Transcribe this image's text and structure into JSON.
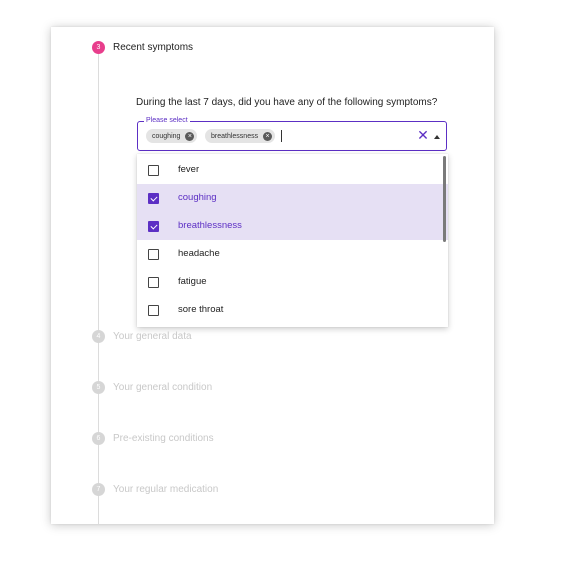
{
  "steps": [
    {
      "number": "3",
      "label": "Recent symptoms",
      "state": "active"
    },
    {
      "number": "4",
      "label": "Your general data",
      "state": "inactive"
    },
    {
      "number": "5",
      "label": "Your general condition",
      "state": "inactive"
    },
    {
      "number": "6",
      "label": "Pre-existing conditions",
      "state": "inactive"
    },
    {
      "number": "7",
      "label": "Your regular medication",
      "state": "inactive"
    }
  ],
  "question": "During the last 7 days, did you have any of the following symptoms?",
  "select": {
    "label": "Please select",
    "chips": [
      {
        "label": "coughing"
      },
      {
        "label": "breathlessness"
      }
    ],
    "clear_icon": "close-icon",
    "toggle_icon": "arrow-up-icon"
  },
  "options": [
    {
      "label": "fever",
      "checked": false
    },
    {
      "label": "coughing",
      "checked": true
    },
    {
      "label": "breathlessness",
      "checked": true
    },
    {
      "label": "headache",
      "checked": false
    },
    {
      "label": "fatigue",
      "checked": false
    },
    {
      "label": "sore throat",
      "checked": false
    }
  ],
  "colors": {
    "accent": "#5c2fc4",
    "active_step": "#e83e8c",
    "selected_row": "#e6e0f4",
    "inactive": "#c8c8c8"
  }
}
